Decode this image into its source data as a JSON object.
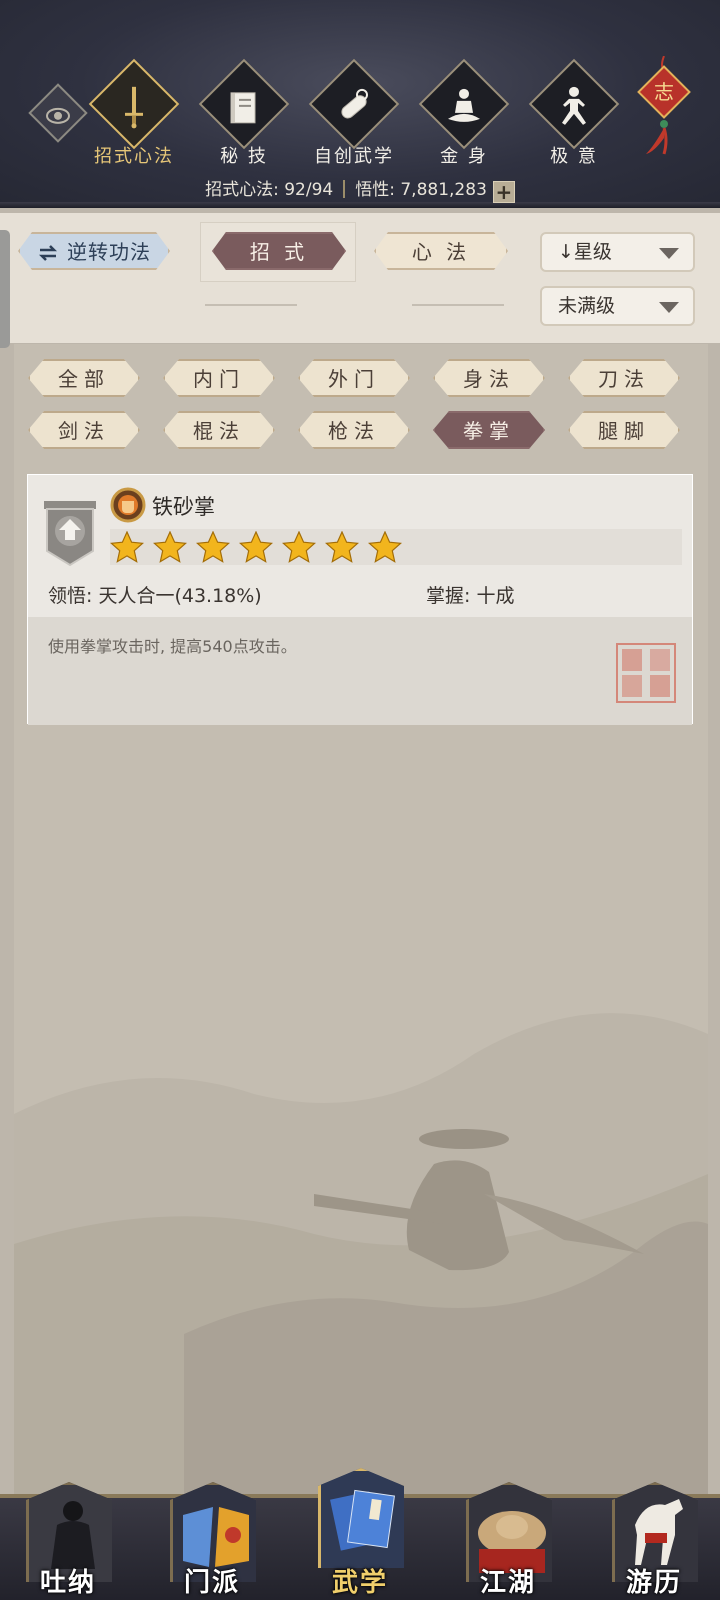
{
  "header": {
    "tabs": [
      {
        "label": "招式心法",
        "icon": "sword-icon",
        "active": true
      },
      {
        "label": "秘 技",
        "icon": "book-icon",
        "active": false
      },
      {
        "label": "自创武学",
        "icon": "scroll-icon",
        "active": false
      },
      {
        "label": "金 身",
        "icon": "meditation-icon",
        "active": false
      },
      {
        "label": "极 意",
        "icon": "stance-icon",
        "active": false
      }
    ],
    "charm_label": "志",
    "stats": {
      "techniques_label": "招式心法: 92/94",
      "insight_label": "悟性: 7,881,283",
      "plus": "+"
    }
  },
  "filters": {
    "reverse_button": "逆转功法",
    "sub_tabs": [
      {
        "label": "招 式",
        "active": true
      },
      {
        "label": "心 法",
        "active": false
      }
    ],
    "sort_dropdown": "星级",
    "level_dropdown": "未满级"
  },
  "categories": [
    {
      "label": "全部",
      "active": false
    },
    {
      "label": "内门",
      "active": false
    },
    {
      "label": "外门",
      "active": false
    },
    {
      "label": "身法",
      "active": false
    },
    {
      "label": "刀法",
      "active": false
    },
    {
      "label": "剑法",
      "active": false
    },
    {
      "label": "棍法",
      "active": false
    },
    {
      "label": "枪法",
      "active": false
    },
    {
      "label": "拳掌",
      "active": true
    },
    {
      "label": "腿脚",
      "active": false
    }
  ],
  "skill": {
    "name": "铁砂掌",
    "stars": 7,
    "comprehension": "领悟: 天人合一(43.18%)",
    "mastery": "掌握: 十成",
    "description": "使用拳掌攻击时, 提高540点攻击。"
  },
  "nav": [
    {
      "label": "吐纳",
      "icon": "meditator-icon",
      "active": false
    },
    {
      "label": "门派",
      "icon": "sect-flags-icon",
      "active": false
    },
    {
      "label": "武学",
      "icon": "martial-books-icon",
      "active": true
    },
    {
      "label": "江湖",
      "icon": "straw-hat-icon",
      "active": false
    },
    {
      "label": "游历",
      "icon": "horse-icon",
      "active": false
    }
  ],
  "colors": {
    "accent_gold": "#e6c678",
    "active_pill": "#7a5b5d",
    "star": "#f2b51d",
    "seal_red": "#d27363"
  }
}
